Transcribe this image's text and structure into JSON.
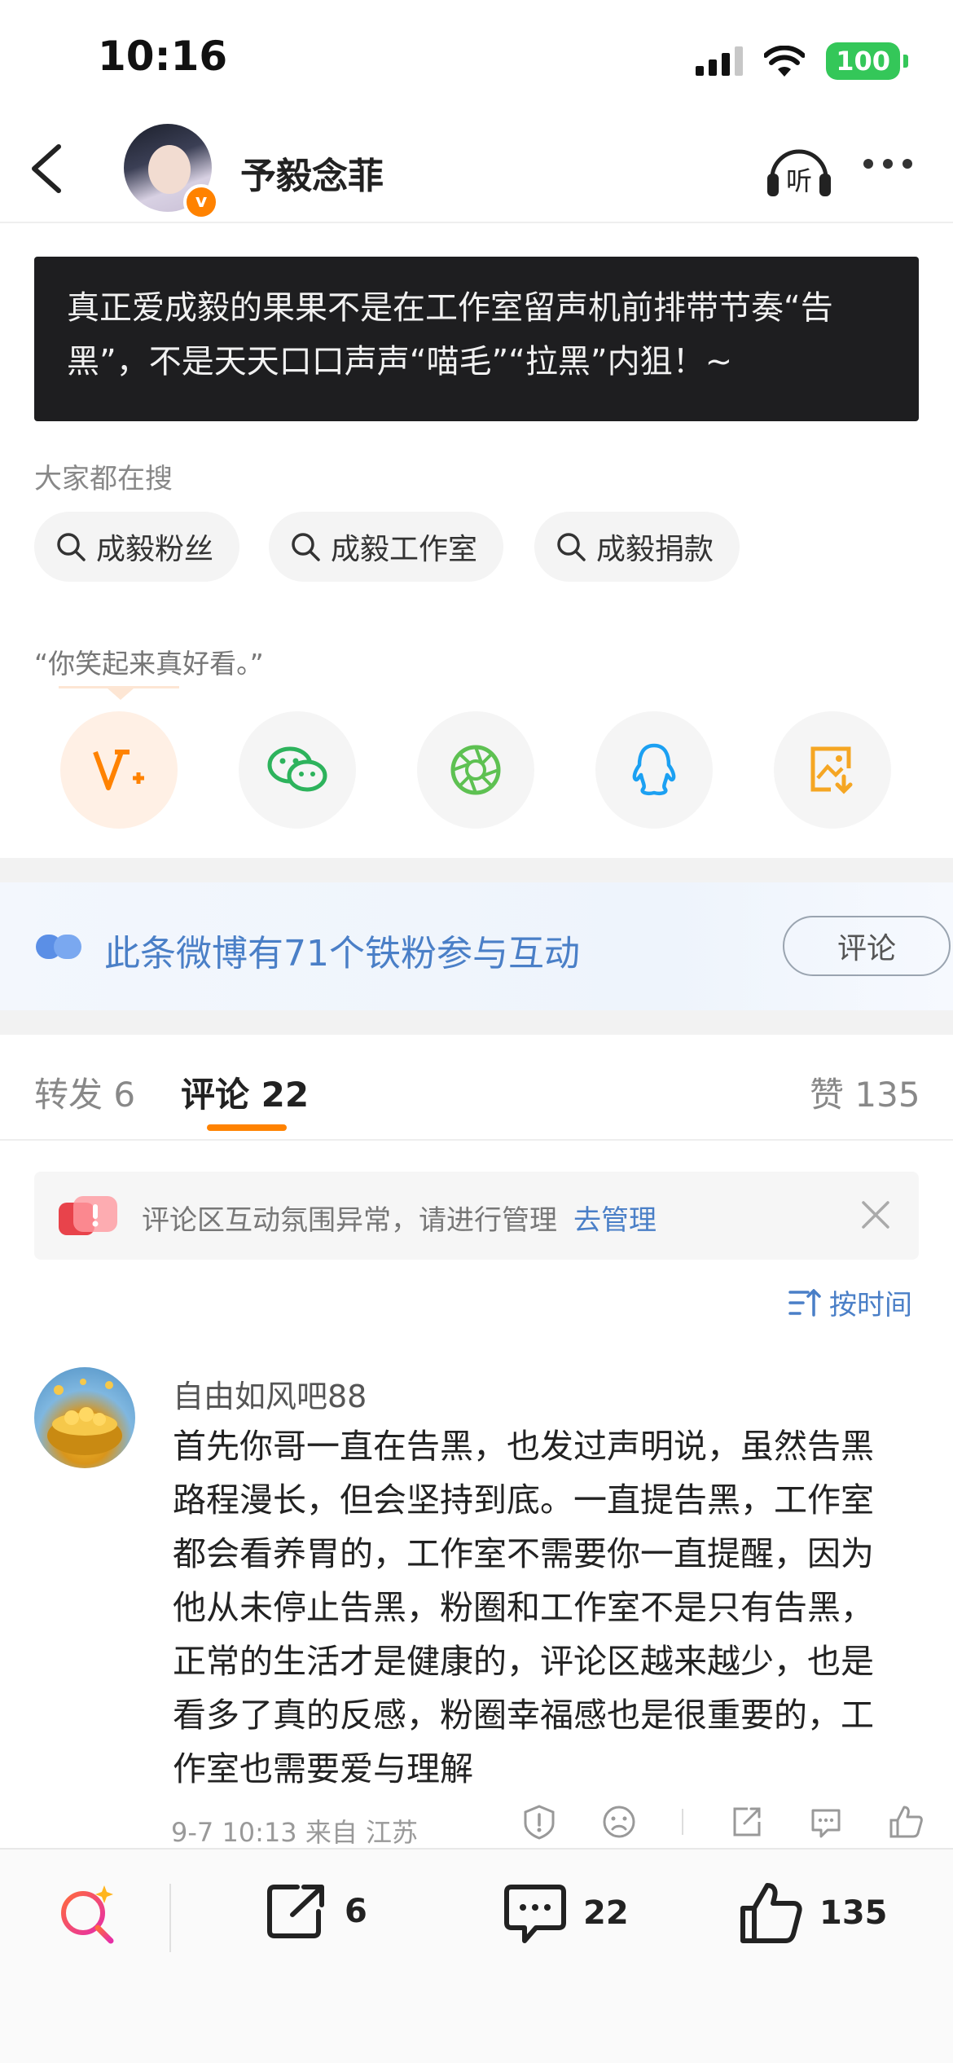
{
  "status_bar": {
    "time": "10:16",
    "battery": "100"
  },
  "nav": {
    "title": "予毅念菲",
    "listen_label": "听"
  },
  "post": {
    "text": "真正爱成毅的果果不是在工作室留声机前排带节奏“告黑”，不是天天口口声声“喵毛”“拉黑”内狙！~"
  },
  "search": {
    "title": "大家都在搜",
    "chips": [
      {
        "label": "成毅粉丝"
      },
      {
        "label": "成毅工作室"
      },
      {
        "label": "成毅捐款"
      }
    ]
  },
  "quote": "“你笑起来真好看。”",
  "share_icons": [
    "v-plus-icon",
    "wechat-icon",
    "moments-icon",
    "qq-icon",
    "save-image-icon"
  ],
  "interaction": {
    "text": "此条微博有71个铁粉参与互动",
    "button": "评论"
  },
  "tabs": {
    "repost": {
      "label": "转发",
      "count": "6"
    },
    "comment": {
      "label": "评论",
      "count": "22"
    },
    "like": {
      "label": "赞",
      "count": "135"
    }
  },
  "notice": {
    "text": "评论区互动氛围异常，请进行管理",
    "link": "去管理"
  },
  "sort": {
    "label": "按时间"
  },
  "comment": {
    "author": "自由如风吧88",
    "body": "首先你哥一直在告黑，也发过声明说，虽然告黑路程漫长，但会坚持到底。一直提告黑，工作室都会看养胃的，工作室不需要你一直提醒，因为他从未停止告黑，粉圈和工作室不是只有告黑，正常的生活才是健康的，评论区越来越少，也是看多了真的反感，粉圈幸福感也是很重要的，工作室也需要爱与理解",
    "meta": "9-7 10:13  来自 江苏"
  },
  "bottom_bar": {
    "repost_count": "6",
    "comment_count": "22",
    "like_count": "135"
  },
  "colors": {
    "accent": "#ff8200",
    "link": "#4a7fc7",
    "dark_card": "#1e1e20"
  }
}
